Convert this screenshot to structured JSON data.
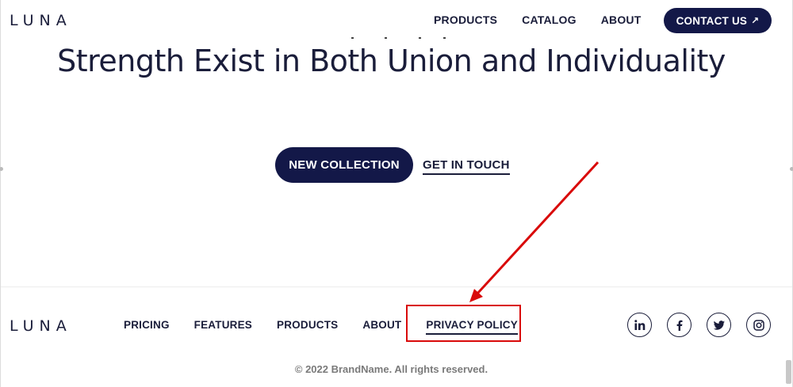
{
  "brand": {
    "logo_text": "LUNA"
  },
  "header": {
    "nav": [
      {
        "label": "PRODUCTS"
      },
      {
        "label": "CATALOG"
      },
      {
        "label": "ABOUT"
      }
    ],
    "contact_label": "CONTACT US",
    "contact_icon": "arrow-up-right-icon"
  },
  "hero": {
    "title": "Strength Exist in Both Union and Individuality",
    "primary_cta": "NEW COLLECTION",
    "secondary_cta": "GET IN TOUCH"
  },
  "footer": {
    "nav": [
      {
        "label": "PRICING"
      },
      {
        "label": "FEATURES"
      },
      {
        "label": "PRODUCTS"
      },
      {
        "label": "ABOUT"
      },
      {
        "label": "PRIVACY POLICY"
      }
    ],
    "social": [
      "linkedin-icon",
      "facebook-icon",
      "twitter-icon",
      "instagram-icon"
    ],
    "copyright": "© 2022 BrandName. All rights reserved."
  },
  "annotation": {
    "color": "#d90a0a",
    "target": "PRIVACY POLICY"
  },
  "colors": {
    "brand_navy": "#131848",
    "text": "#1a1d3a"
  }
}
